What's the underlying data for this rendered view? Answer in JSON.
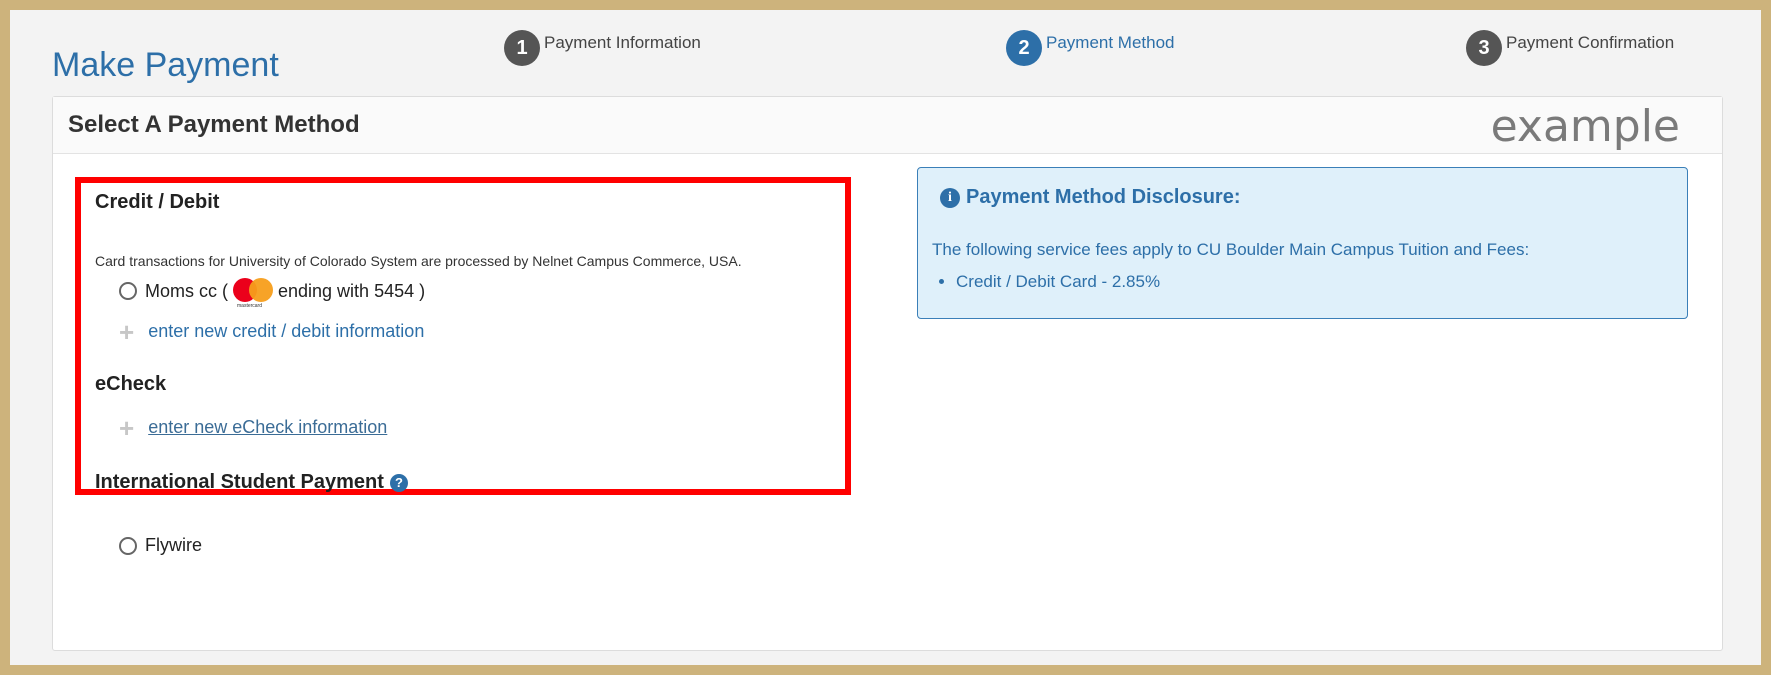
{
  "page_title": "Make Payment",
  "steps": [
    {
      "number": "1",
      "label": "Payment Information",
      "active": false
    },
    {
      "number": "2",
      "label": "Payment Method",
      "active": true
    },
    {
      "number": "3",
      "label": "Payment Confirmation",
      "active": false
    }
  ],
  "panel": {
    "title": "Select A Payment Method",
    "watermark": "example"
  },
  "credit_debit": {
    "heading": "Credit / Debit",
    "note": "Card transactions for University of Colorado System are processed by Nelnet Campus Commerce, USA.",
    "saved_card": {
      "name_prefix": "Moms cc (",
      "brand": "mastercard",
      "suffix": "ending with 5454 )"
    },
    "add_link": "enter new credit / debit information"
  },
  "echeck": {
    "heading": "eCheck",
    "add_link": "enter new eCheck information"
  },
  "international": {
    "heading": "International Student Payment",
    "option": "Flywire"
  },
  "disclosure": {
    "title": "Payment Method Disclosure:",
    "text": "The following service fees apply to CU Boulder Main Campus Tuition and Fees:",
    "items": [
      "Credit / Debit Card - 2.85%"
    ]
  },
  "colors": {
    "brand_blue": "#2d6fa8",
    "highlight_red": "#ff0000",
    "frame_gold": "#cdb37c"
  }
}
